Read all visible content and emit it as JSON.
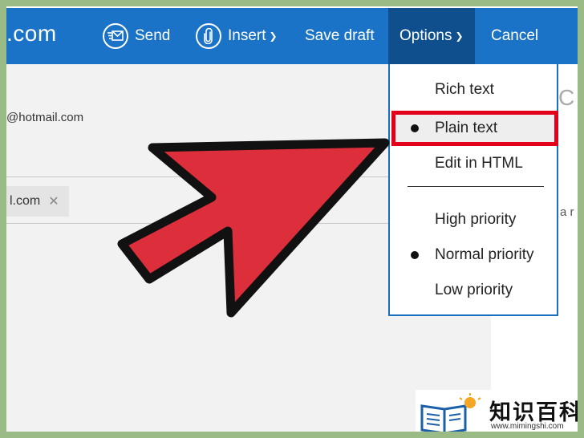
{
  "toolbar": {
    "brand_suffix": ".com",
    "send_label": "Send",
    "insert_label": "Insert",
    "save_draft_label": "Save draft",
    "options_label": "Options",
    "cancel_label": "Cancel"
  },
  "compose": {
    "from_fragment": "@hotmail.com",
    "to_chip_fragment": "l.com",
    "right_letter_fragment": "C",
    "right_text_fragment": "a r"
  },
  "options_menu": {
    "items": [
      {
        "label": "Rich text",
        "selected": false
      },
      {
        "label": "Plain text",
        "selected": true,
        "highlighted": true
      },
      {
        "label": "Edit in HTML",
        "selected": false
      },
      {
        "label": "High priority",
        "selected": false
      },
      {
        "label": "Normal priority",
        "selected": true
      },
      {
        "label": "Low priority",
        "selected": false
      }
    ]
  },
  "watermark": {
    "cn_text": "知识百科",
    "url": "www.mimingshi.com"
  },
  "colors": {
    "toolbar": "#1a73c6",
    "options_active": "#0f4f8e",
    "highlight_box": "#e3001b",
    "arrow_fill": "#dd2e3b",
    "page_border": "#9aba86"
  }
}
